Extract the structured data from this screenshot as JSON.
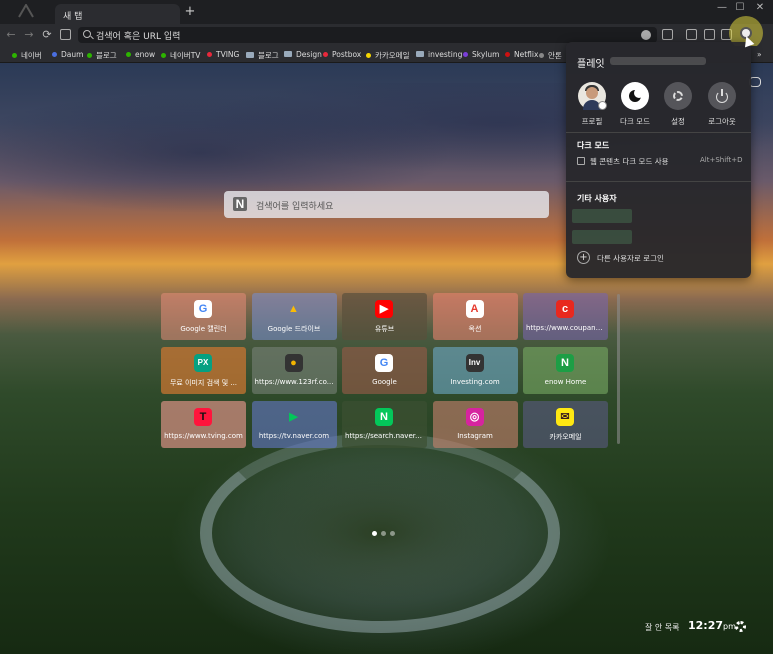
{
  "tab": {
    "title": "새 탭",
    "new_tab": "+"
  },
  "window": {
    "min": "—",
    "max": "☐",
    "close": "✕"
  },
  "nav": {
    "back": "←",
    "forward": "→",
    "reload": "⟳"
  },
  "omnibox": {
    "placeholder": "검색어 혹은 URL 입력"
  },
  "bookmarks": [
    {
      "label": "네이버",
      "color": "#2db400"
    },
    {
      "label": "Daum",
      "color": "#4a6ee0"
    },
    {
      "label": "블로그",
      "color": "#2db400"
    },
    {
      "label": "enow",
      "color": "#2db400"
    },
    {
      "label": "네이버TV",
      "color": "#2db400"
    },
    {
      "label": "TVING",
      "color": "#e8283b"
    },
    {
      "label": "블로그",
      "folder": true
    },
    {
      "label": "Design",
      "folder": true
    },
    {
      "label": "Postbox",
      "color": "#e8283b"
    },
    {
      "label": "카카오메일",
      "color": "#f7d700"
    },
    {
      "label": "investing",
      "folder": true
    },
    {
      "label": "Skylum",
      "color": "#7a3ed8"
    },
    {
      "label": "Netflix",
      "color": "#c11"
    },
    {
      "label": "안론",
      "color": "#888"
    }
  ],
  "bookmarks_more": "»",
  "search": {
    "placeholder": "검색어를 입력하세요",
    "logo": "N"
  },
  "tiles": [
    {
      "label": "Google 캘린더",
      "icon": "G",
      "icon_bg": "#ffffff",
      "icon_fg": "#4285f4",
      "bg": "rgba(230,140,120,0.55)"
    },
    {
      "label": "Google 드라이브",
      "icon": "▲",
      "icon_bg": "transparent",
      "icon_fg": "#fbbc04",
      "bg": "rgba(120,140,200,0.6)"
    },
    {
      "label": "유튜브",
      "icon": "▶",
      "icon_bg": "#ff0000",
      "icon_fg": "#ffffff",
      "bg": "rgba(90,80,60,0.7)"
    },
    {
      "label": "옥션",
      "icon": "A",
      "icon_bg": "#ffffff",
      "icon_fg": "#e63a2e",
      "bg": "rgba(230,130,110,0.6)"
    },
    {
      "label": "https://www.coupang...",
      "icon": "c",
      "icon_bg": "#e8281e",
      "icon_fg": "#ffffff",
      "bg": "rgba(120,100,170,0.6)"
    },
    {
      "label": "무료 이미지 검색 및 ...",
      "icon": "PX",
      "icon_bg": "#05a081",
      "icon_fg": "#ffffff",
      "bg": "rgba(210,120,50,0.7)"
    },
    {
      "label": "https://www.123rf.co...",
      "icon": "●",
      "icon_bg": "#333333",
      "icon_fg": "#f2b400",
      "bg": "rgba(120,130,120,0.6)"
    },
    {
      "label": "Google",
      "icon": "G",
      "icon_bg": "#ffffff",
      "icon_fg": "#4285f4",
      "bg": "rgba(140,90,70,0.7)"
    },
    {
      "label": "Investing.com",
      "icon": "Inv",
      "icon_bg": "#333333",
      "icon_fg": "#ffffff",
      "bg": "rgba(110,170,200,0.6)"
    },
    {
      "label": "enow Home",
      "icon": "N",
      "icon_bg": "#1d9e45",
      "icon_fg": "#ffffff",
      "bg": "rgba(120,170,100,0.6)"
    },
    {
      "label": "https://www.tving.com",
      "icon": "T",
      "icon_bg": "#ff153c",
      "icon_fg": "#111111",
      "bg": "rgba(230,150,140,0.65)"
    },
    {
      "label": "https://tv.naver.com",
      "icon": "▶",
      "icon_bg": "transparent",
      "icon_fg": "#03c75a",
      "bg": "rgba(100,120,200,0.6)"
    },
    {
      "label": "https://search.naver.c...",
      "icon": "N",
      "icon_bg": "#03c75a",
      "icon_fg": "#ffffff",
      "bg": "rgba(60,80,50,0.7)"
    },
    {
      "label": "Instagram",
      "icon": "◎",
      "icon_bg": "#d6249f",
      "icon_fg": "#ffffff",
      "bg": "rgba(200,130,110,0.6)"
    },
    {
      "label": "카카오메일",
      "icon": "✉",
      "icon_bg": "#ffe812",
      "icon_fg": "#3c1e1e",
      "bg": "rgba(90,90,130,0.6)"
    }
  ],
  "footer": {
    "phrase": "잘 안 목록",
    "time": "12:27",
    "ampm": "pm"
  },
  "popup": {
    "user_name": "플레잇",
    "buttons": [
      {
        "label": "프로필"
      },
      {
        "label": "다크 모드"
      },
      {
        "label": "설정"
      },
      {
        "label": "로그아웃"
      }
    ],
    "dark_mode_title": "다크 모드",
    "dark_web_label": "웹 콘텐츠 다크 모드 사용",
    "dark_web_shortcut": "Alt+Shift+D",
    "other_users_title": "기타 사용자",
    "add_user_label": "다른 사용자로 로그인",
    "add_icon": "+"
  }
}
